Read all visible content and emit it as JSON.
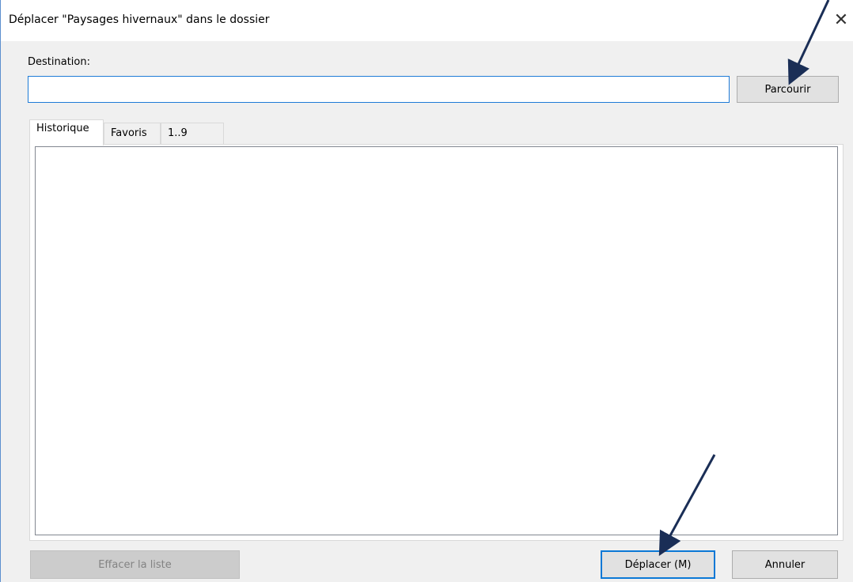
{
  "window": {
    "title": "Déplacer \"Paysages hivernaux\" dans le dossier",
    "close_symbol": "✕",
    "accent_color": "#0b78d6"
  },
  "form": {
    "destination_label": "Destination:",
    "destination_value": "",
    "browse_label": "Parcourir"
  },
  "tabs": [
    {
      "label": "Historique",
      "active": true
    },
    {
      "label": "Favoris",
      "active": false
    },
    {
      "label": "1..9",
      "active": false
    }
  ],
  "list": {
    "items": []
  },
  "footer": {
    "clear_label": "Effacer la liste",
    "move_label": "Déplacer (M)",
    "cancel_label": "Annuler"
  },
  "annotations": {
    "arrow_color": "#1a2e56"
  }
}
